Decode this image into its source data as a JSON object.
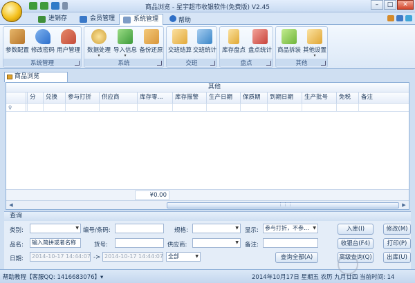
{
  "window": {
    "title": "商品浏览 - 星宇超市收银软件(免费版) V2.45",
    "buttons": {
      "minimize": "–",
      "restore": "□",
      "close": "✕"
    }
  },
  "tabs": [
    {
      "label": "进销存",
      "color": "#3f8f3a"
    },
    {
      "label": "会员管理",
      "color": "#3a78c8"
    },
    {
      "label": "系统管理",
      "color": "#7d9cc6",
      "active": true
    },
    {
      "label": "帮助",
      "color": "#2f6fc6"
    }
  ],
  "ribbon": {
    "groups": [
      {
        "label": "系统管理",
        "buttons": [
          {
            "label": "参数配置",
            "icon": "tools-icon",
            "color": "#b7752a"
          },
          {
            "label": "修改密码",
            "icon": "key-icon",
            "color": "#2c6fcc"
          },
          {
            "label": "用户管理",
            "icon": "users-icon",
            "color": "#c44b3a"
          }
        ]
      },
      {
        "label": "系统",
        "buttons": [
          {
            "label": "数据处理",
            "icon": "gear-icon",
            "color": "#d1a23a",
            "dropdown": "▾"
          },
          {
            "label": "导入信息",
            "icon": "import-icon",
            "color": "#3c9a3a",
            "dropdown": "▾"
          },
          {
            "label": "备份还原",
            "icon": "backup-icon",
            "color": "#d9963a"
          }
        ]
      },
      {
        "label": "交班",
        "buttons": [
          {
            "label": "交班结算",
            "icon": "calendar-icon",
            "color": "#e2a93a"
          },
          {
            "label": "交班统计",
            "icon": "stats-icon",
            "color": "#3a86c8"
          }
        ]
      },
      {
        "label": "盘点",
        "buttons": [
          {
            "label": "库存盘点",
            "icon": "calculator-icon",
            "color": "#e0a833"
          },
          {
            "label": "盘点统计",
            "icon": "chart-icon",
            "color": "#c8433a"
          }
        ]
      },
      {
        "label": "其他",
        "buttons": [
          {
            "label": "商品拆装",
            "icon": "boxes-icon",
            "color": "#6fb53a"
          },
          {
            "label": "其他设置",
            "icon": "settings-icon",
            "color": "#e0a533",
            "dropdown": "▾"
          }
        ]
      }
    ]
  },
  "doc_tab": {
    "label": "商品浏览"
  },
  "grid": {
    "band_header": "其他",
    "columns": [
      "分",
      "兑换",
      "参与打折",
      "供应商",
      "库存零...",
      "库存报警",
      "生产日期",
      "保质期",
      "到期日期",
      "生产批号",
      "免税",
      "备注"
    ],
    "filter_icon": "♀",
    "sum_value": "¥0.00",
    "scroll": {
      "left": "◀",
      "right": "▶",
      "grip": "⋮⋮⋮"
    }
  },
  "query": {
    "title": "查询",
    "labels": {
      "category": "类别:",
      "code": "编号/条码:",
      "spec": "规格:",
      "display": "显示:",
      "name": "品名:",
      "goods_no": "货号:",
      "supplier": "供应商:",
      "remark": "备注:",
      "date": "日期:",
      "arrow": "->"
    },
    "inputs": {
      "category": "",
      "code": "",
      "spec": "",
      "display": "参与打折，不参...",
      "name": "输入简拼或者名称",
      "goods_no": "",
      "supplier": "",
      "remark": "",
      "date_from": "2014-10-17 14:44:07",
      "date_to": "2014-10-17 14:44:07",
      "date_range": "全部"
    },
    "buttons": {
      "query_all": "查询全部(A)",
      "stock_in": "入库(I)",
      "modify": "修改(M)",
      "cashier": "收银台(F4)",
      "print": "打印(P)",
      "advanced": "高级查询(Q)",
      "stock_out": "出库(U)"
    }
  },
  "status": {
    "help": "帮助教程【客服QQ: 1416683076】▾",
    "date": "2014年10月17日 星期五 农历 九月廿四 当前时间: 14"
  }
}
